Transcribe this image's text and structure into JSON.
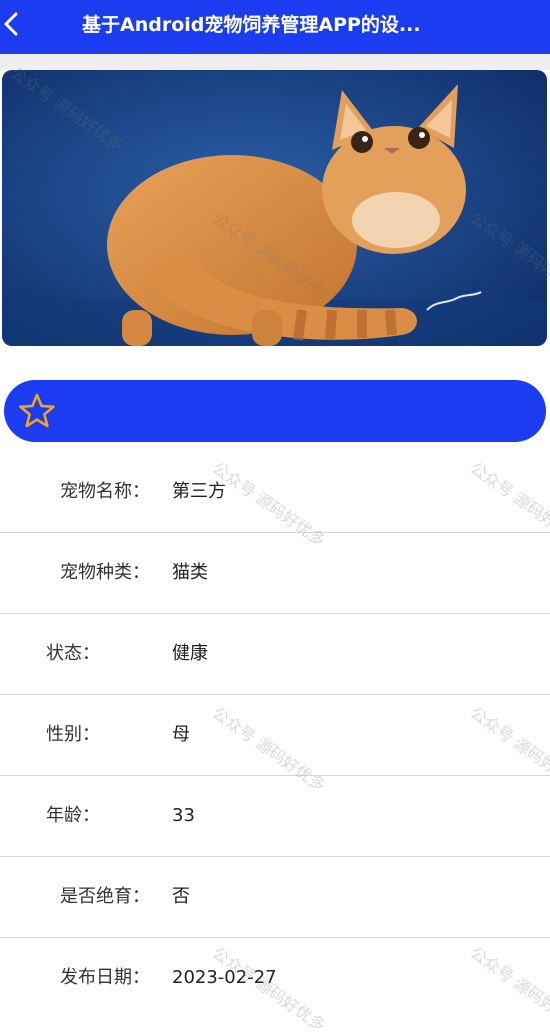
{
  "header": {
    "title": "基于Android宠物饲养管理APP的设..."
  },
  "pet": {
    "image_alt": "orange exotic shorthair cat on blue background",
    "favorite_icon": "star-outline-icon"
  },
  "details": [
    {
      "label": "宠物名称：",
      "value": "第三方"
    },
    {
      "label": "宠物种类：",
      "value": "猫类"
    },
    {
      "label": "状态：",
      "value": "健康"
    },
    {
      "label": "性别：",
      "value": "母"
    },
    {
      "label": "年龄：",
      "value": "33"
    },
    {
      "label": "是否绝育：",
      "value": "否"
    },
    {
      "label": "发布日期：",
      "value": "2023-02-27"
    }
  ],
  "watermark": "公众号 源码好优多",
  "colors": {
    "primary": "#1b3cf0",
    "star": "#f2a51a"
  }
}
